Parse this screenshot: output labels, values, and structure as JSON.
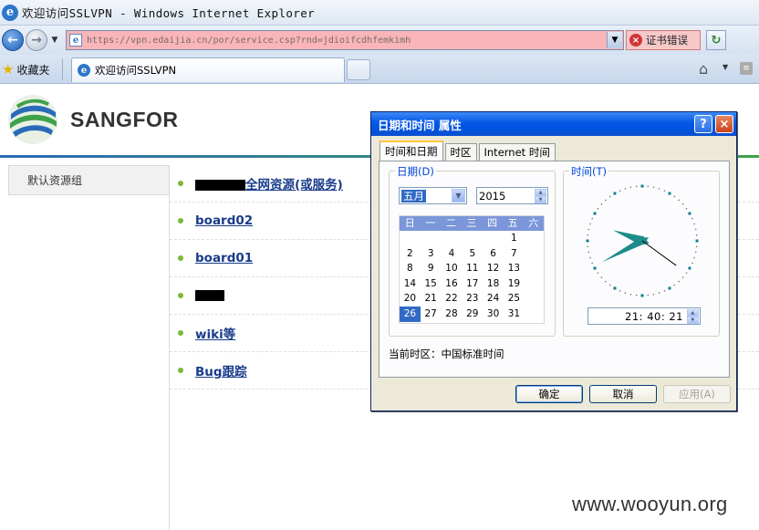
{
  "window": {
    "title": "欢迎访问SSLVPN - Windows Internet Explorer",
    "colors": {
      "titlebar": "#dfe8f3",
      "url_bg_error": "#f9b5b7",
      "dialog_title": "#0054e3",
      "accent_green": "#7bb83a",
      "link": "#1a3c8a"
    }
  },
  "addressbar": {
    "url": "https://vpn.edaijia.cn/por/service.csp?rnd=jdioifcdhfemkimh",
    "cert_error_label": "证书错误",
    "icons": {
      "back": "back-arrow-icon",
      "forward": "forward-arrow-icon",
      "refresh": "refresh-icon",
      "cert": "cert-error-icon"
    }
  },
  "tabbar": {
    "favorites_label": "收藏夹",
    "tab_title": "欢迎访问SSLVPN",
    "icons": {
      "favorites": "star-icon",
      "home": "home-icon",
      "feed": "feed-icon"
    }
  },
  "page": {
    "logo_text": "SANGFOR",
    "sidebar": {
      "items": [
        {
          "label": "默认资源组"
        }
      ]
    },
    "resources": [
      {
        "label": "全网资源(或服务)",
        "redacted": true
      },
      {
        "label": "board02"
      },
      {
        "label": "board01"
      },
      {
        "label": "",
        "redacted": true
      },
      {
        "label": "wiki等"
      },
      {
        "label": "Bug跟踪"
      }
    ]
  },
  "dialog": {
    "title": "日期和时间 属性",
    "help": "?",
    "close": "×",
    "tabs": [
      "时间和日期",
      "时区",
      "Internet 时间"
    ],
    "date_group_label": "日期(D)",
    "time_group_label": "时间(T)",
    "month": "五月",
    "year": "2015",
    "weekdays": [
      "日",
      "一",
      "二",
      "三",
      "四",
      "五",
      "六"
    ],
    "days": [
      "",
      "",
      "",
      "",
      "",
      "1",
      "2",
      "3",
      "4",
      "5",
      "6",
      "7",
      "8",
      "9",
      "10",
      "11",
      "12",
      "13",
      "14",
      "15",
      "16",
      "17",
      "18",
      "19",
      "20",
      "21",
      "22",
      "23",
      "24",
      "25",
      "26",
      "27",
      "28",
      "29",
      "30",
      "31",
      "",
      "",
      "",
      "",
      "",
      ""
    ],
    "selected_day": "26",
    "time": "21: 40: 21",
    "timezone_label": "当前时区：",
    "timezone_value": "中国标准时间",
    "buttons": {
      "ok": "确定",
      "cancel": "取消",
      "apply": "应用(A)"
    }
  },
  "watermark": "www.wooyun.org"
}
